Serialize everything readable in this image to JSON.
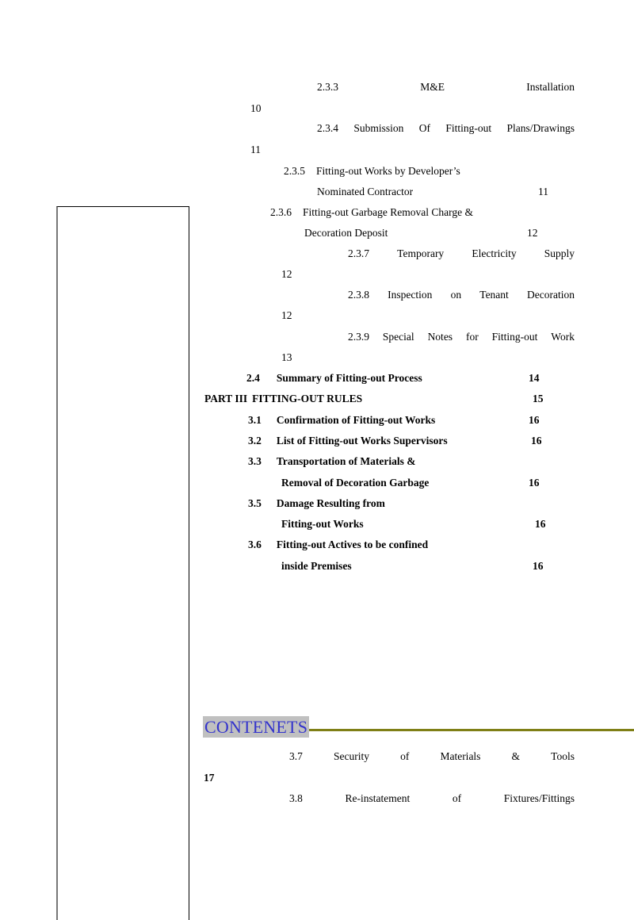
{
  "document": {
    "heading": "CONTENETS",
    "heading_color": "#3333cc",
    "heading_highlight_color": "#c0c0c0",
    "rule_color": "#7f7f16"
  },
  "entries": [
    {
      "number": "2.3.3",
      "words": [
        "M&E",
        "Installation"
      ],
      "page": "10",
      "style": "spread",
      "page_side": "left"
    },
    {
      "number": "2.3.4",
      "words": [
        "Submission",
        "Of",
        "Fitting-out",
        "Plans/Drawings"
      ],
      "page": "11",
      "style": "spread",
      "page_side": "left"
    },
    {
      "number": "2.3.5",
      "title": "Fitting-out Works by Developer’s",
      "cont": "Nominated Contractor",
      "page": "11",
      "style": "normal"
    },
    {
      "number": "2.3.6",
      "title": "Fitting-out Garbage Removal Charge &",
      "cont": "Decoration Deposit",
      "page": "12",
      "style": "normal"
    },
    {
      "number": "2.3.7",
      "words": [
        "Temporary",
        "Electricity",
        "Supply"
      ],
      "page": "12",
      "style": "spread",
      "page_side": "left"
    },
    {
      "number": "2.3.8",
      "words": [
        "Inspection",
        "on",
        "Tenant",
        "Decoration"
      ],
      "page": "12",
      "style": "spread",
      "page_side": "left"
    },
    {
      "number": "2.3.9",
      "words": [
        "Special",
        "Notes",
        "for",
        "Fitting-out",
        "Work"
      ],
      "page": "13",
      "style": "spread",
      "page_side": "left"
    },
    {
      "number": "2.4",
      "title": "Summary of Fitting-out Process",
      "page": "14",
      "style": "bold"
    },
    {
      "number": "PART III",
      "title": "FITTING-OUT RULES",
      "page": "15",
      "style": "bold-part"
    },
    {
      "number": "3.1",
      "title": "Confirmation of Fitting-out Works",
      "page": "16",
      "style": "bold"
    },
    {
      "number": "3.2",
      "title": "List of Fitting-out Works Supervisors",
      "page": "16",
      "style": "bold"
    },
    {
      "number": "3.3",
      "title": "Transportation of Materials &",
      "cont": "Removal of Decoration Garbage",
      "page": "16",
      "style": "bold"
    },
    {
      "number": "3.5",
      "title": "Damage Resulting from",
      "cont": "Fitting-out Works",
      "page": "16",
      "style": "bold"
    },
    {
      "number": "3.6",
      "title": "Fitting-out Actives to be confined",
      "cont": "inside Premises",
      "page": "16",
      "style": "bold"
    },
    {
      "number": "3.7",
      "words": [
        "Security",
        "of",
        "Materials",
        "&",
        "Tools"
      ],
      "page": "17",
      "style": "spread-bold",
      "page_side": "left"
    },
    {
      "number": "3.8",
      "words": [
        "Re-instatement",
        "of",
        "Fixtures/Fittings"
      ],
      "page": "",
      "style": "spread-bold",
      "page_side": "none"
    }
  ],
  "labels": {
    "l1_num": "2.3.3",
    "l1_w1": "M&E",
    "l1_w2": "Installation",
    "l1_page": "10",
    "l2_num": "2.3.4",
    "l2_w1": "Submission",
    "l2_w2": "Of",
    "l2_w3": "Fitting-out",
    "l2_w4": "Plans/Drawings",
    "l2_page": "11",
    "l3_num": "2.3.5",
    "l3_t": "Fitting-out Works by Developer’s",
    "l3_c": "Nominated Contractor",
    "l3_page": "11",
    "l4_num": "2.3.6",
    "l4_t": "Fitting-out Garbage Removal Charge &",
    "l4_c": "Decoration Deposit",
    "l4_page": "12",
    "l5_num": "2.3.7",
    "l5_w1": "Temporary",
    "l5_w2": "Electricity",
    "l5_w3": "Supply",
    "l5_page": "12",
    "l6_num": "2.3.8",
    "l6_w1": "Inspection",
    "l6_w2": "on",
    "l6_w3": "Tenant",
    "l6_w4": "Decoration",
    "l6_page": "12",
    "l7_num": "2.3.9",
    "l7_w1": "Special",
    "l7_w2": "Notes",
    "l7_w3": "for",
    "l7_w4": "Fitting-out",
    "l7_w5": "Work",
    "l7_page": "13",
    "l8_num": "2.4",
    "l8_t": "Summary of Fitting-out Process",
    "l8_page": "14",
    "l9_num": "PART III",
    "l9_t": "FITTING-OUT RULES",
    "l9_page": "15",
    "l10_num": "3.1",
    "l10_t": "Confirmation of Fitting-out Works",
    "l10_page": "16",
    "l11_num": "3.2",
    "l11_t": "List of Fitting-out Works Supervisors",
    "l11_page": "16",
    "l12_num": "3.3",
    "l12_t": "Transportation of Materials &",
    "l12_c": "Removal of Decoration Garbage",
    "l12_page": "16",
    "l13_num": "3.5",
    "l13_t": "Damage Resulting from",
    "l13_c": "Fitting-out Works",
    "l13_page": "16",
    "l14_num": "3.6",
    "l14_t": "Fitting-out Actives to be confined",
    "l14_c": "inside Premises",
    "l14_page": "16",
    "l15_num": "3.7",
    "l15_w1": "Security",
    "l15_w2": "of",
    "l15_w3": "Materials",
    "l15_w4": "&",
    "l15_w5": "Tools",
    "l15_page": "17",
    "l16_num": "3.8",
    "l16_w1": "Re-instatement",
    "l16_w2": "of",
    "l16_w3": "Fixtures/Fittings"
  }
}
